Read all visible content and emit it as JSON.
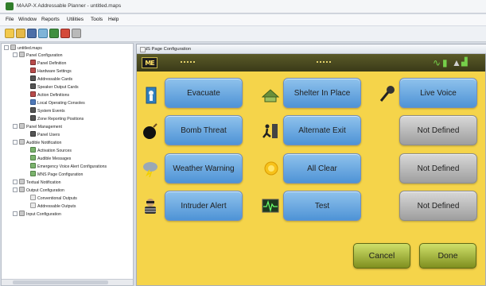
{
  "window": {
    "title": "MAAP-X Addressable Planner - untitled.maps"
  },
  "menu": [
    "File",
    "Window",
    "Reports",
    "Utilities",
    "Tools",
    "Help"
  ],
  "tree": [
    {
      "label": "untitled.maps",
      "icon": "folder-icon"
    },
    {
      "label": "Panel Configuration",
      "icon": "folder-icon"
    },
    {
      "label": "Panel Definition",
      "icon": "panel-icon"
    },
    {
      "label": "Hardware Settings",
      "icon": "hardware-icon"
    },
    {
      "label": "Addressable Cards",
      "icon": "card-icon"
    },
    {
      "label": "Speaker Output Cards",
      "icon": "speaker-icon"
    },
    {
      "label": "Action Definitions",
      "icon": "action-icon"
    },
    {
      "label": "Local Operating Consoles",
      "icon": "console-icon"
    },
    {
      "label": "System Events",
      "icon": "events-icon"
    },
    {
      "label": "Zone Reporting Positions",
      "icon": "zone-icon"
    },
    {
      "label": "Panel Management",
      "icon": "folder-icon"
    },
    {
      "label": "Panel Users",
      "icon": "users-icon"
    },
    {
      "label": "Audible Notification",
      "icon": "folder-icon"
    },
    {
      "label": "Activation Sources",
      "icon": "activation-icon"
    },
    {
      "label": "Audible Messages",
      "icon": "messages-icon"
    },
    {
      "label": "Emergency Voice Alert Configurations",
      "icon": "alert-icon"
    },
    {
      "label": "MNS Page Configuration",
      "icon": "page-icon"
    },
    {
      "label": "Textual Notification",
      "icon": "folder-icon"
    },
    {
      "label": "Output Configuration",
      "icon": "folder-icon"
    },
    {
      "label": "Conventional Outputs",
      "icon": "outputs-icon"
    },
    {
      "label": "Addressable Outputs",
      "icon": "outputs-icon"
    },
    {
      "label": "Input Configuration",
      "icon": "folder-icon"
    }
  ],
  "dialog": {
    "title": "MNS Page Configuration",
    "logo": "ME",
    "buttons": [
      {
        "label": "Evacuate",
        "icon": "evacuate-icon",
        "style": "blue"
      },
      {
        "label": "Shelter In Place",
        "icon": "shelter-icon",
        "style": "blue"
      },
      {
        "label": "Live Voice",
        "icon": "microphone-icon",
        "style": "blue"
      },
      {
        "label": "Bomb Threat",
        "icon": "bomb-icon",
        "style": "blue"
      },
      {
        "label": "Alternate Exit",
        "icon": "alternate-exit-icon",
        "style": "blue"
      },
      {
        "label": "Not Defined",
        "icon": "",
        "style": "gray"
      },
      {
        "label": "Weather Warning",
        "icon": "weather-icon",
        "style": "blue"
      },
      {
        "label": "All Clear",
        "icon": "all-clear-icon",
        "style": "blue"
      },
      {
        "label": "Not Defined",
        "icon": "",
        "style": "gray"
      },
      {
        "label": "Intruder Alert",
        "icon": "intruder-icon",
        "style": "blue"
      },
      {
        "label": "Test",
        "icon": "test-icon",
        "style": "blue"
      },
      {
        "label": "Not Defined",
        "icon": "",
        "style": "gray"
      }
    ],
    "cancel_label": "Cancel",
    "done_label": "Done"
  }
}
